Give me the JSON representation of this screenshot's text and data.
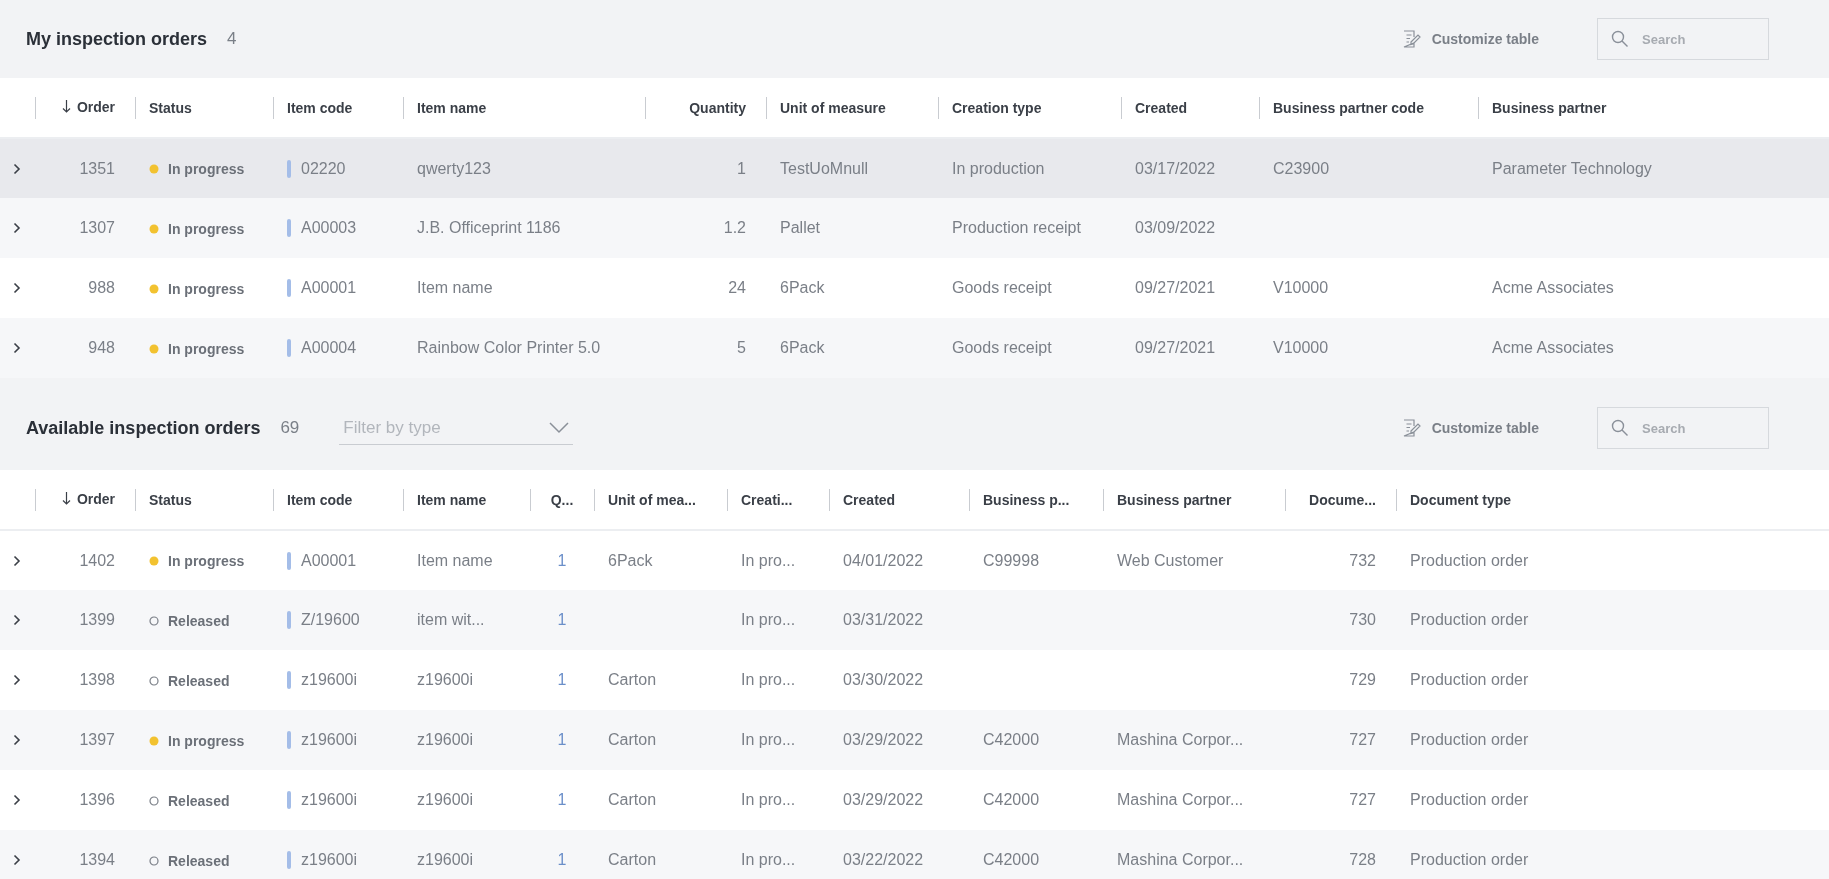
{
  "sections": [
    {
      "title": "My inspection orders",
      "count": "4",
      "toolbar": {
        "customize": "Customize table",
        "search": {
          "placeholder": "Search"
        }
      },
      "table": {
        "columns": [
          {
            "label": "Order",
            "kind": "number",
            "sorted": true
          },
          {
            "label": "Status",
            "kind": "status"
          },
          {
            "label": "Item code",
            "kind": "code"
          },
          {
            "label": "Item name",
            "kind": "text"
          },
          {
            "label": "Quantity",
            "kind": "number"
          },
          {
            "label": "Unit of measure",
            "kind": "text"
          },
          {
            "label": "Creation type",
            "kind": "text"
          },
          {
            "label": "Created",
            "kind": "text"
          },
          {
            "label": "Business partner code",
            "kind": "text"
          },
          {
            "label": "Business partner",
            "kind": "text"
          }
        ],
        "rows": [
          {
            "selected": true,
            "cells": [
              "1351",
              {
                "text": "In progress",
                "kind": "in_progress"
              },
              "02220",
              "qwerty123",
              "1",
              "TestUoMnull",
              "In production",
              "03/17/2022",
              "C23900",
              "Parameter Technology"
            ]
          },
          {
            "selected": false,
            "cells": [
              "1307",
              {
                "text": "In progress",
                "kind": "in_progress"
              },
              "A00003",
              "J.B. Officeprint 1186",
              "1.2",
              "Pallet",
              "Production receipt",
              "03/09/2022",
              null,
              null
            ]
          },
          {
            "selected": false,
            "cells": [
              "988",
              {
                "text": "In progress",
                "kind": "in_progress"
              },
              "A00001",
              "Item name",
              "24",
              "6Pack",
              "Goods receipt",
              "09/27/2021",
              "V10000",
              "Acme Associates"
            ]
          },
          {
            "selected": false,
            "cells": [
              "948",
              {
                "text": "In progress",
                "kind": "in_progress"
              },
              "A00004",
              "Rainbow Color Printer 5.0",
              "5",
              "6Pack",
              "Goods receipt",
              "09/27/2021",
              "V10000",
              "Acme Associates"
            ]
          }
        ]
      }
    },
    {
      "title": "Available inspection orders",
      "count": "69",
      "filter": {
        "placeholder": "Filter by type"
      },
      "toolbar": {
        "customize": "Customize table",
        "search": {
          "placeholder": "Search"
        }
      },
      "table": {
        "columns": [
          {
            "label": "Order",
            "kind": "number",
            "sorted": true
          },
          {
            "label": "Status",
            "kind": "status"
          },
          {
            "label": "Item code",
            "kind": "code"
          },
          {
            "label": "Item name",
            "kind": "text"
          },
          {
            "label": "Q...",
            "kind": "qty"
          },
          {
            "label": "Unit of mea...",
            "kind": "text"
          },
          {
            "label": "Creati...",
            "kind": "text"
          },
          {
            "label": "Created",
            "kind": "text"
          },
          {
            "label": "Business p...",
            "kind": "text"
          },
          {
            "label": "Business partner",
            "kind": "text"
          },
          {
            "label": "Docume...",
            "kind": "number"
          },
          {
            "label": "Document type",
            "kind": "text"
          }
        ],
        "rows": [
          {
            "selected": false,
            "cells": [
              "1402",
              {
                "text": "In progress",
                "kind": "in_progress"
              },
              "A00001",
              "Item name",
              "1",
              "6Pack",
              "In pro...",
              "04/01/2022",
              "C99998",
              "Web Customer",
              "732",
              "Production order"
            ]
          },
          {
            "selected": false,
            "cells": [
              "1399",
              {
                "text": "Released",
                "kind": "released"
              },
              "Z/19600",
              "item wit...",
              "1",
              null,
              "In pro...",
              "03/31/2022",
              null,
              null,
              "730",
              "Production order"
            ]
          },
          {
            "selected": false,
            "cells": [
              "1398",
              {
                "text": "Released",
                "kind": "released"
              },
              "z19600i",
              "z19600i",
              "1",
              "Carton",
              "In pro...",
              "03/30/2022",
              null,
              null,
              "729",
              "Production order"
            ]
          },
          {
            "selected": false,
            "cells": [
              "1397",
              {
                "text": "In progress",
                "kind": "in_progress"
              },
              "z19600i",
              "z19600i",
              "1",
              "Carton",
              "In pro...",
              "03/29/2022",
              "C42000",
              "Mashina Corpor...",
              "727",
              "Production order"
            ]
          },
          {
            "selected": false,
            "cells": [
              "1396",
              {
                "text": "Released",
                "kind": "released"
              },
              "z19600i",
              "z19600i",
              "1",
              "Carton",
              "In pro...",
              "03/29/2022",
              "C42000",
              "Mashina Corpor...",
              "727",
              "Production order"
            ]
          },
          {
            "selected": false,
            "cells": [
              "1394",
              {
                "text": "Released",
                "kind": "released"
              },
              "z19600i",
              "z19600i",
              "1",
              "Carton",
              "In pro...",
              "03/22/2022",
              "C42000",
              "Mashina Corpor...",
              "728",
              "Production order"
            ]
          }
        ]
      }
    }
  ]
}
